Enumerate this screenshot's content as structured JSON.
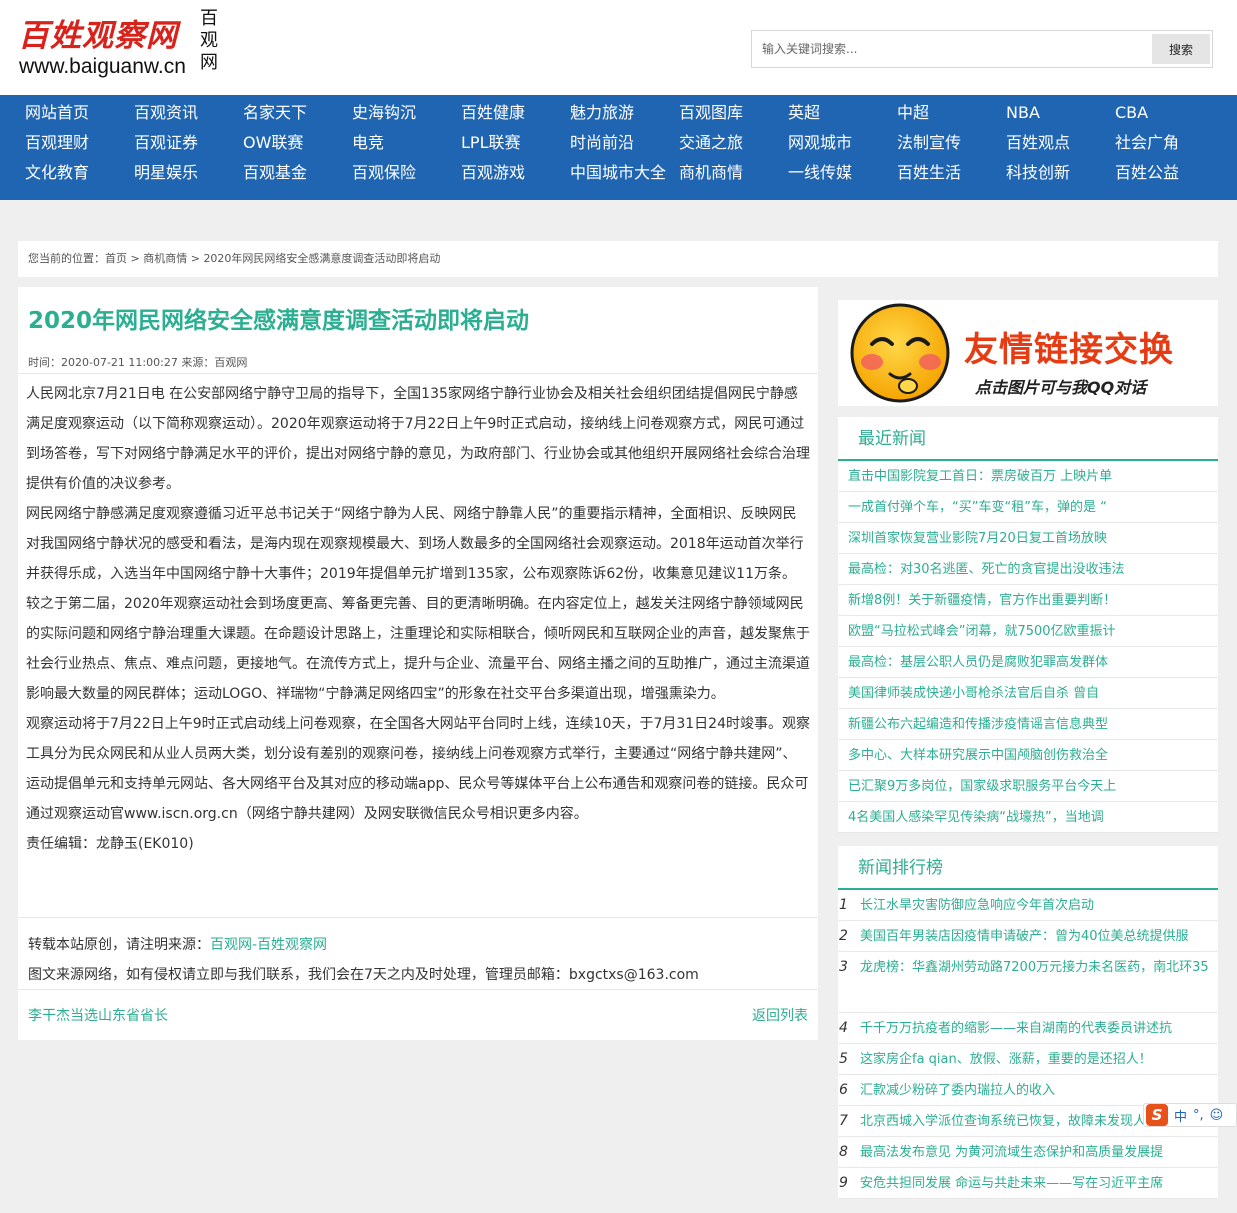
{
  "header": {
    "logo_title": "百姓观察网",
    "logo_side": "百观网",
    "logo_url": "www.baiguanw.cn",
    "search_placeholder": "输入关键词搜索...",
    "search_button": "搜索"
  },
  "nav": {
    "rows": [
      [
        "网站首页",
        "百观资讯",
        "名家天下",
        "史海钩沉",
        "百姓健康",
        "魅力旅游",
        "百观图库",
        "英超",
        "中超",
        "NBA",
        "CBA"
      ],
      [
        "百观理财",
        "百观证券",
        "OW联赛",
        "电竞",
        "LPL联赛",
        "时尚前沿",
        "交通之旅",
        "网观城市",
        "法制宣传",
        "百姓观点",
        "社会广角"
      ],
      [
        "文化教育",
        "明星娱乐",
        "百观基金",
        "百观保险",
        "百观游戏",
        "中国城市大全",
        "商机商情",
        "一线传媒",
        "百姓生活",
        "科技创新",
        "百姓公益"
      ]
    ]
  },
  "breadcrumb": {
    "prefix": "您当前的位置：",
    "home": "首页",
    "sep1": " > ",
    "category": "商机商情",
    "sep2": " > ",
    "current": "2020年网民网络安全感满意度调查活动即将启动"
  },
  "article": {
    "title": "2020年网民网络安全感满意度调查活动即将启动",
    "meta": "时间：2020-07-21 11:00:27 来源：百观网",
    "paragraphs": [
      "人民网北京7月21日电 在公安部网络宁静守卫局的指导下，全国135家网络宁静行业协会及相关社会组织团结提倡网民宁静感满足度观察运动（以下简称观察运动）。2020年观察运动将于7月22日上午9时正式启动，接纳线上问卷观察方式，网民可通过到场答卷，写下对网络宁静满足水平的评价，提出对网络宁静的意见，为政府部门、行业协会或其他组织开展网络社会综合治理提供有价值的决议参考。",
      "网民网络宁静感满足度观察遵循习近平总书记关于“网络宁静为人民、网络宁静靠人民”的重要指示精神，全面相识、反映网民对我国网络宁静状况的感受和看法，是海内现在观察规模最大、到场人数最多的全国网络社会观察运动。2018年运动首次举行并获得乐成，入选当年中国网络宁静十大事件；2019年提倡单元扩增到135家，公布观察陈诉62份，收集意见建议11万条。",
      "较之于第二届，2020年观察运动社会到场度更高、筹备更完善、目的更清晰明确。在内容定位上，越发关注网络宁静领域网民的实际问题和网络宁静治理重大课题。在命题设计思路上，注重理论和实际相联合，倾听网民和互联网企业的声音，越发聚焦于社会行业热点、焦点、难点问题，更接地气。在流传方式上，提升与企业、流量平台、网络主播之间的互助推广，通过主流渠道影响最大数量的网民群体；运动LOGO、祥瑞物“宁静满足网络四宝”的形象在社交平台多渠道出现，增强熏染力。",
      "观察运动将于7月22日上午9时正式启动线上问卷观察，在全国各大网站平台同时上线，连续10天，于7月31日24时竣事。观察工具分为民众网民和从业人员两大类，划分设有差别的观察问卷，接纳线上问卷观察方式举行，主要通过“网络宁静共建网”、运动提倡单元和支持单元网站、各大网络平台及其对应的移动端app、民众号等媒体平台上公布通告和观察问卷的链接。民众可通过观察运动官www.iscn.org.cn（网络宁静共建网）及网安联微信民众号相识更多内容。",
      "责任编辑：龙静玉(EK010)"
    ],
    "reprint_prefix": "转载本站原创，请注明来源：",
    "reprint_source": "百观网-百姓观察网",
    "copyright": "图文来源网络，如有侵权请立即与我们联系，我们会在7天之内及时处理，管理员邮箱：bxgctxs@163.com",
    "prev_link": "李干杰当选山东省省长",
    "back_link": "返回列表"
  },
  "sidebar": {
    "banner_title": "友情链接交换",
    "banner_sub": "点击图片可与我QQ对话",
    "recent": {
      "title": "最近新闻",
      "items": [
        "直击中国影院复工首日：票房破百万 上映片单",
        "一成首付弹个车，“买”车变“租”车，弹的是 “",
        "深圳首家恢复营业影院7月20日复工首场放映",
        "最高检：对30名逃匿、死亡的贪官提出没收违法",
        "新增8例！关于新疆疫情，官方作出重要判断！",
        "欧盟“马拉松式峰会”闭幕，就7500亿欧重振计",
        "最高检：基层公职人员仍是腐败犯罪高发群体",
        "美国律师装成快递小哥枪杀法官后自杀 曾自",
        "新疆公布六起编造和传播涉疫情谣言信息典型",
        "多中心、大样本研究展示中国颅脑创伤救治全",
        "已汇聚9万多岗位，国家级求职服务平台今天上",
        "4名美国人感染罕见传染病“战壕热”，当地调"
      ]
    },
    "ranking": {
      "title": "新闻排行榜",
      "items": [
        {
          "num": "1",
          "text": "长江水旱灾害防御应急响应今年首次启动"
        },
        {
          "num": "2",
          "text": "美国百年男装店因疫情申请破产：曾为40位美总统提供服"
        },
        {
          "num": "3",
          "text": "龙虎榜：华鑫湖州劳动路7200万元接力未名医药，南北环35"
        },
        {
          "num": "4",
          "text": "千千万万抗疫者的缩影——来自湖南的代表委员讲述抗"
        },
        {
          "num": "5",
          "text": "这家房企fa qian、放假、涨薪，重要的是还招人！"
        },
        {
          "num": "6",
          "text": "汇款减少粉碎了委内瑞拉人的收入"
        },
        {
          "num": "7",
          "text": "北京西城入学派位查询系统已恢复，故障未发现人为因素"
        },
        {
          "num": "8",
          "text": "最高法发布意见 为黄河流域生态保护和高质量发展提"
        },
        {
          "num": "9",
          "text": "安危共担同发展 命运与共赴未来——写在习近平主席"
        }
      ]
    }
  },
  "ime": {
    "mode": "中",
    "punct": "°,"
  }
}
